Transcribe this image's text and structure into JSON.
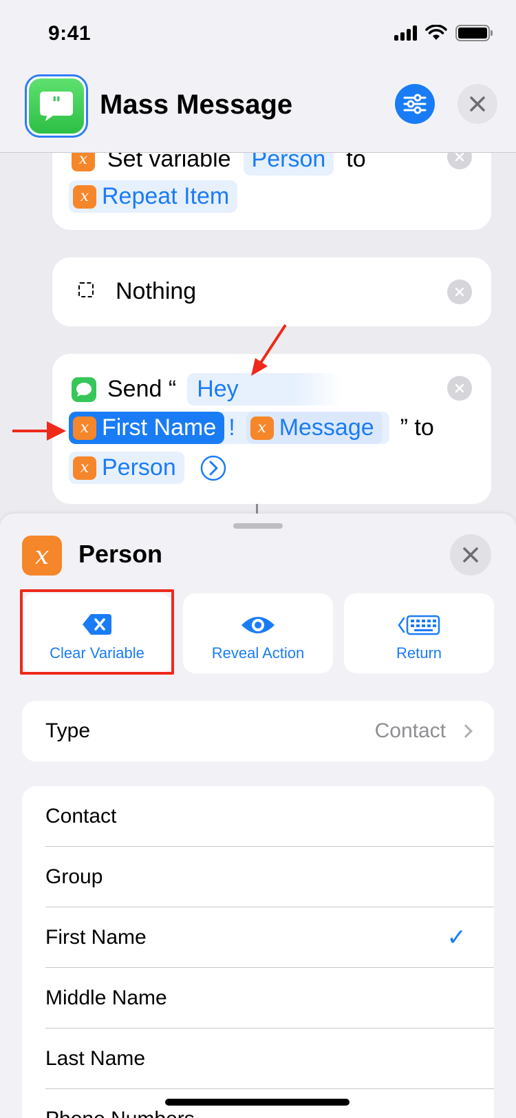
{
  "status_bar": {
    "time": "9:41"
  },
  "header": {
    "title": "Mass Message"
  },
  "actions": {
    "set_variable": {
      "prefix": "Set variable",
      "variable": "Person",
      "connector": "to",
      "value": "Repeat Item"
    },
    "nothing": {
      "label": "Nothing"
    },
    "send": {
      "prefix": "Send “",
      "text_hey": "Hey",
      "token_first_name": "First Name",
      "exclaim": "!",
      "token_message": "Message",
      "suffix": "” to",
      "token_person": "Person"
    }
  },
  "sheet": {
    "title": "Person",
    "buttons": {
      "clear": "Clear Variable",
      "reveal": "Reveal Action",
      "return": "Return"
    },
    "type_row": {
      "label": "Type",
      "value": "Contact"
    },
    "list": [
      {
        "label": "Contact",
        "checked": false
      },
      {
        "label": "Group",
        "checked": false
      },
      {
        "label": "First Name",
        "checked": true
      },
      {
        "label": "Middle Name",
        "checked": false
      },
      {
        "label": "Last Name",
        "checked": false
      },
      {
        "label": "Phone Numbers",
        "checked": false
      }
    ],
    "check_mark": "✓"
  },
  "colors": {
    "accent": "#1a7cf5",
    "variable": "#f6862a",
    "annotation": "#ee2a1b",
    "messages": "#35c759"
  }
}
